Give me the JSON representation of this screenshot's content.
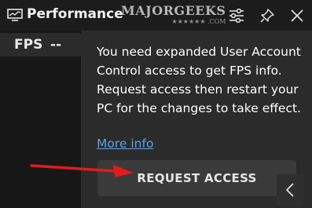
{
  "window": {
    "title": "Performance",
    "icons": {
      "app": "performance-monitor-icon",
      "settings": "settings-sliders-icon",
      "pin": "pin-icon",
      "close": "close-icon",
      "collapse": "chevron-left-icon"
    }
  },
  "watermark": {
    "text": "MAJORGEEKS",
    "subtext": "★★★★★★ .COM"
  },
  "metrics": {
    "fps_label": "FPS",
    "fps_value": "--"
  },
  "popup": {
    "message": "You need expanded User Account Control access to get FPS info. Request access then restart your PC for the changes to take effect.",
    "link_text": "More info",
    "button_label": "REQUEST ACCESS"
  },
  "colors": {
    "link": "#5ea1e6",
    "annotation_arrow": "#e21b1b",
    "panel_bg": "#2b2b2b",
    "window_bg": "#171717"
  }
}
